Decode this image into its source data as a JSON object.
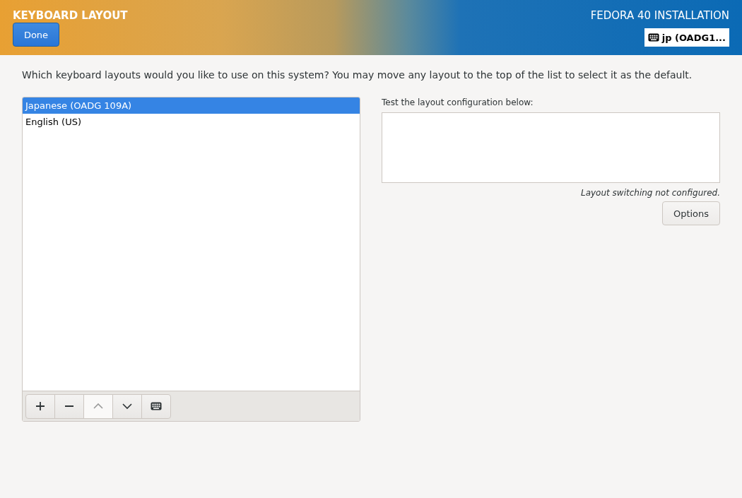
{
  "header": {
    "title": "KEYBOARD LAYOUT",
    "done_button": "Done",
    "product": "FEDORA 40 INSTALLATION",
    "keyboard_indicator": "jp (OADG1..."
  },
  "prompt": "Which keyboard layouts would you like to use on this system?  You may move any layout to the top of the list to select it as the default.",
  "layouts": [
    {
      "label": "Japanese (OADG 109A)",
      "selected": true
    },
    {
      "label": "English (US)",
      "selected": false
    }
  ],
  "toolbar": [
    {
      "kind": "add",
      "disabled": false
    },
    {
      "kind": "remove",
      "disabled": false
    },
    {
      "kind": "up",
      "disabled": true
    },
    {
      "kind": "down",
      "disabled": false
    },
    {
      "kind": "keyboard",
      "disabled": false
    }
  ],
  "test": {
    "label": "Test the layout configuration below:",
    "status": "Layout switching not configured.",
    "options_button": "Options"
  }
}
